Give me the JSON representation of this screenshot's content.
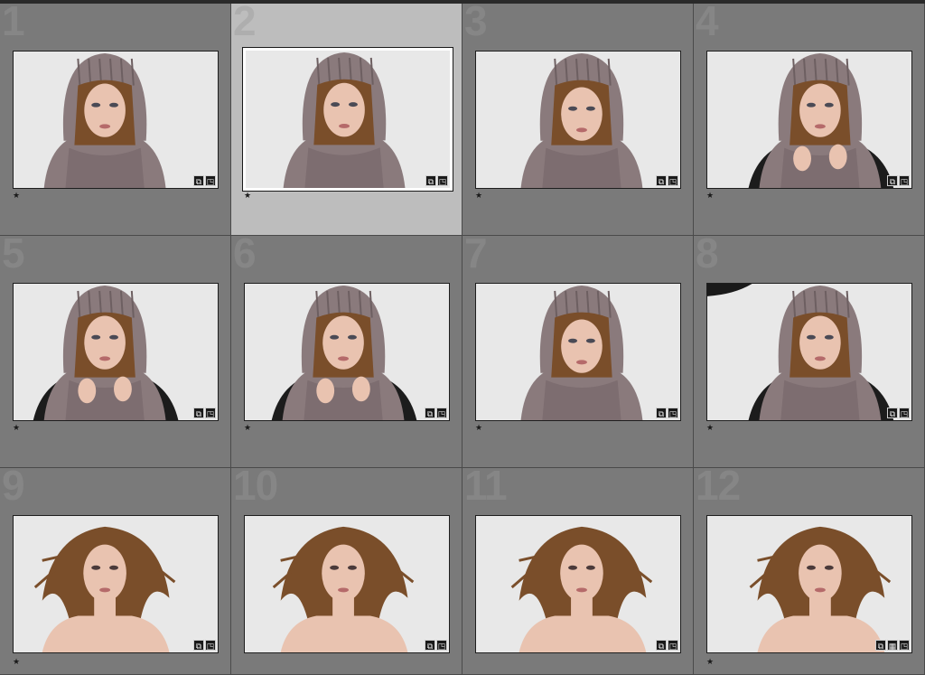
{
  "cells": [
    {
      "index": "1",
      "rating": "★",
      "selected": false,
      "style": "hood",
      "badges": [
        "edit-tag-icon",
        "crop-icon"
      ]
    },
    {
      "index": "2",
      "rating": "★",
      "selected": true,
      "style": "hood",
      "badges": [
        "edit-tag-icon",
        "crop-icon"
      ]
    },
    {
      "index": "3",
      "rating": "★",
      "selected": false,
      "style": "hoodclose",
      "badges": [
        "edit-tag-icon",
        "crop-icon"
      ]
    },
    {
      "index": "4",
      "rating": "★",
      "selected": false,
      "style": "hoodhands",
      "badges": [
        "edit-tag-icon",
        "crop-icon"
      ]
    },
    {
      "index": "5",
      "rating": "★",
      "selected": false,
      "style": "hoodhands",
      "badges": [
        "edit-tag-icon",
        "crop-icon"
      ]
    },
    {
      "index": "6",
      "rating": "★",
      "selected": false,
      "style": "hoodhands",
      "badges": [
        "edit-tag-icon",
        "crop-icon"
      ]
    },
    {
      "index": "7",
      "rating": "★",
      "selected": false,
      "style": "hoodclose",
      "badges": [
        "edit-tag-icon",
        "crop-icon"
      ]
    },
    {
      "index": "8",
      "rating": "★",
      "selected": false,
      "style": "hoodside",
      "badges": [
        "edit-tag-icon",
        "crop-icon"
      ]
    },
    {
      "index": "9",
      "rating": "★",
      "selected": false,
      "style": "hair",
      "badges": [
        "edit-tag-icon",
        "crop-icon"
      ]
    },
    {
      "index": "10",
      "rating": "",
      "selected": false,
      "style": "hair",
      "badges": [
        "edit-tag-icon",
        "crop-icon"
      ]
    },
    {
      "index": "11",
      "rating": "",
      "selected": false,
      "style": "hair",
      "badges": [
        "edit-tag-icon",
        "crop-icon"
      ]
    },
    {
      "index": "12",
      "rating": "★",
      "selected": false,
      "style": "hair",
      "badges": [
        "edit-tag-icon",
        "stack-icon",
        "crop-icon"
      ]
    }
  ],
  "colors": {
    "grid_bg": "#7a7a7a",
    "selected_bg": "#bdbdbd",
    "knit": "#8a7a7c",
    "hair": "#7a4e2a",
    "skin": "#e9c3b0",
    "backdrop": "#e6e6e6"
  },
  "glyphs": {
    "edit-tag-icon": "⧉",
    "crop-icon": "◳",
    "stack-icon": "▦"
  }
}
